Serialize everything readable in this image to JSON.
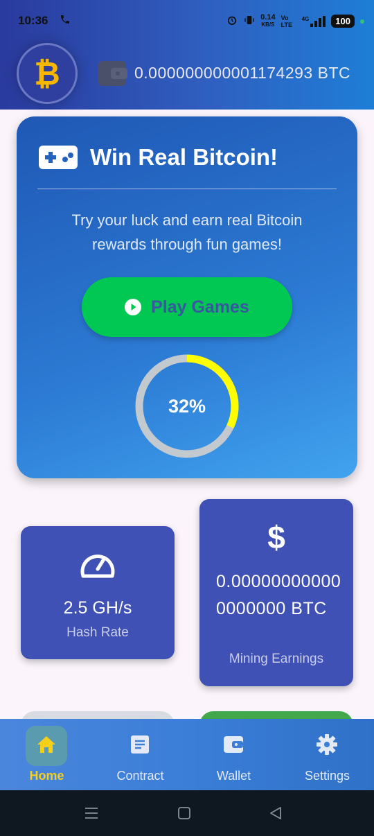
{
  "status_bar": {
    "time": "10:36",
    "data_speed": "0.14",
    "data_unit": "KB/S",
    "volte": "Vo LTE",
    "network": "4G",
    "battery": "100"
  },
  "header": {
    "logo_symbol": "₿",
    "balance": "0.000000000001174293 BTC"
  },
  "game_card": {
    "title": "Win Real Bitcoin!",
    "subtitle": "Try your luck and earn real Bitcoin rewards through fun games!",
    "play_button_label": "Play Games",
    "progress_label": "32%",
    "progress_value": 0.32
  },
  "stats": {
    "hash_rate_value": "2.5 GH/s",
    "hash_rate_label": "Hash Rate",
    "earnings_symbol": "$",
    "earnings_value": "0.000000000000000000 BTC",
    "earnings_label": "Mining Earnings"
  },
  "bottom_nav": {
    "items": [
      {
        "label": "Home",
        "icon": "home-icon",
        "active": true
      },
      {
        "label": "Contract",
        "icon": "document-icon",
        "active": false
      },
      {
        "label": "Wallet",
        "icon": "wallet-icon",
        "active": false
      },
      {
        "label": "Settings",
        "icon": "gear-icon",
        "active": false
      }
    ]
  },
  "colors": {
    "accent_green": "#00c853",
    "accent_yellow": "#f5cf1a",
    "progress_yellow": "#ffff00",
    "card_indigo": "#3f51b5"
  }
}
